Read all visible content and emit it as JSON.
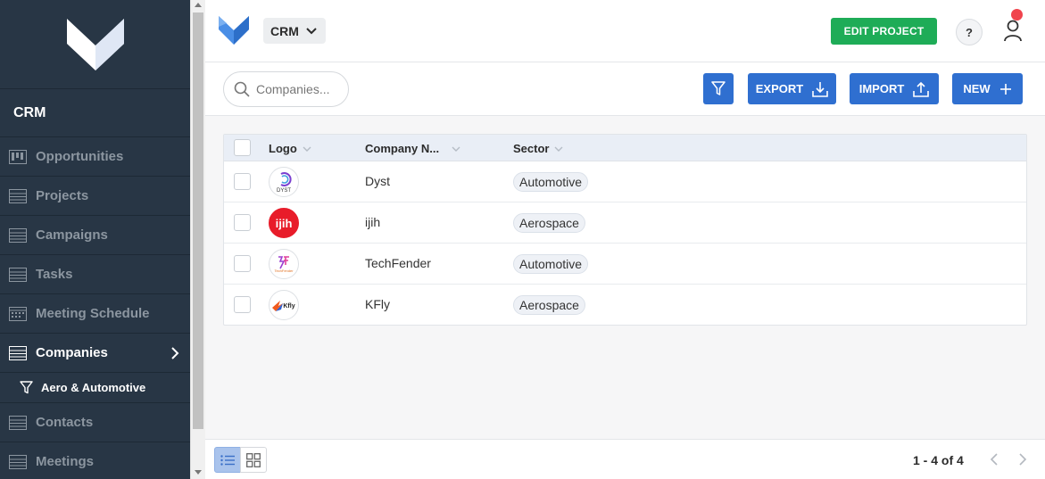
{
  "sidebar": {
    "title": "CRM",
    "items": [
      {
        "label": "Opportunities",
        "icon": "kanban-icon",
        "active": false
      },
      {
        "label": "Projects",
        "icon": "table-icon",
        "active": false
      },
      {
        "label": "Campaigns",
        "icon": "table-icon",
        "active": false
      },
      {
        "label": "Tasks",
        "icon": "table-icon",
        "active": false
      },
      {
        "label": "Meeting Schedule",
        "icon": "calendar-icon",
        "active": false
      },
      {
        "label": "Companies",
        "icon": "table-icon",
        "active": true
      },
      {
        "label": "Contacts",
        "icon": "table-icon",
        "active": false
      },
      {
        "label": "Meetings",
        "icon": "table-icon",
        "active": false
      }
    ],
    "subitem": {
      "label": "Aero & Automotive",
      "icon": "filter-icon"
    }
  },
  "header": {
    "app_select": "CRM",
    "edit_label": "EDIT PROJECT",
    "help_label": "?"
  },
  "toolbar": {
    "search_placeholder": "Companies...",
    "export_label": "EXPORT",
    "import_label": "IMPORT",
    "new_label": "NEW"
  },
  "table": {
    "columns": [
      "Logo",
      "Company N...",
      "Sector"
    ],
    "rows": [
      {
        "logo_text": "DYST",
        "name": "Dyst",
        "sector": "Automotive"
      },
      {
        "logo_text": "ijih",
        "name": "ijih",
        "sector": "Aerospace"
      },
      {
        "logo_text": "TechFender",
        "name": "TechFender",
        "sector": "Automotive"
      },
      {
        "logo_text": "Kfly",
        "name": "KFly",
        "sector": "Aerospace"
      }
    ]
  },
  "footer": {
    "pagination": "1 - 4 of 4"
  },
  "colors": {
    "sidebar_bg": "#283645",
    "primary": "#2f6fd0",
    "success": "#1eac57",
    "notification": "#f0444d"
  }
}
